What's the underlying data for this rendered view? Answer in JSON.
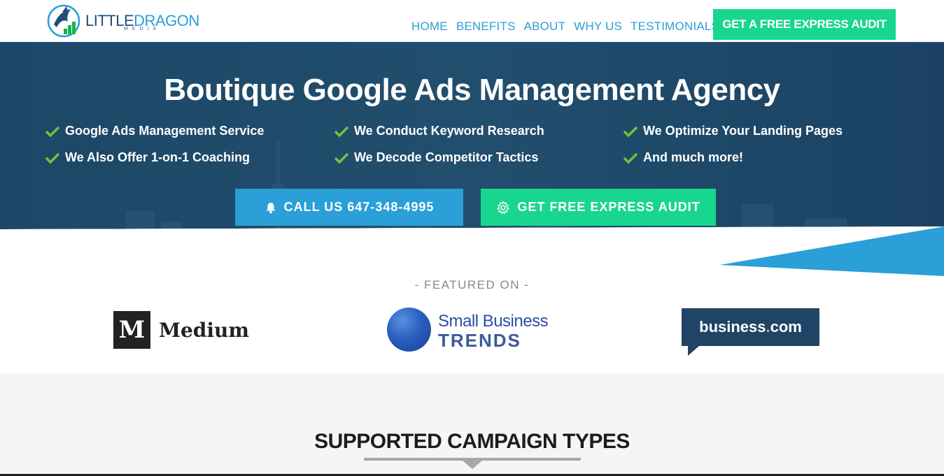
{
  "brand": {
    "name_part1": "LITTLE",
    "name_part2": "DRAGON",
    "sub": "MEDIA"
  },
  "nav": {
    "items": [
      {
        "label": "HOME"
      },
      {
        "label": "BENEFITS"
      },
      {
        "label": "ABOUT"
      },
      {
        "label": "WHY US"
      },
      {
        "label": "TESTIMONIALS"
      }
    ],
    "cta": "GET A FREE EXPRESS AUDIT"
  },
  "hero": {
    "title": "Boutique Google Ads Management Agency",
    "features": [
      "Google Ads Management Service",
      "We Conduct Keyword Research",
      "We Optimize Your Landing Pages",
      "We Also Offer 1-on-1 Coaching",
      "We Decode Competitor Tactics",
      "And much more!"
    ],
    "call_button": "CALL US 647-348-4995",
    "audit_button": "GET FREE EXPRESS AUDIT"
  },
  "featured": {
    "label": "- FEATURED ON -",
    "medium": {
      "mark": "M",
      "word": "Medium"
    },
    "sbt": {
      "line1": "Small Business",
      "line2": "TRENDS"
    },
    "bizcom": {
      "part1": "business",
      "dot": ".",
      "part2": "com"
    }
  },
  "supported": {
    "title": "SUPPORTED CAMPAIGN TYPES"
  },
  "colors": {
    "navy": "#1f4e79",
    "accent_blue": "#2a9fd8",
    "accent_green": "#19d68e",
    "check_green": "#6bc63c"
  }
}
